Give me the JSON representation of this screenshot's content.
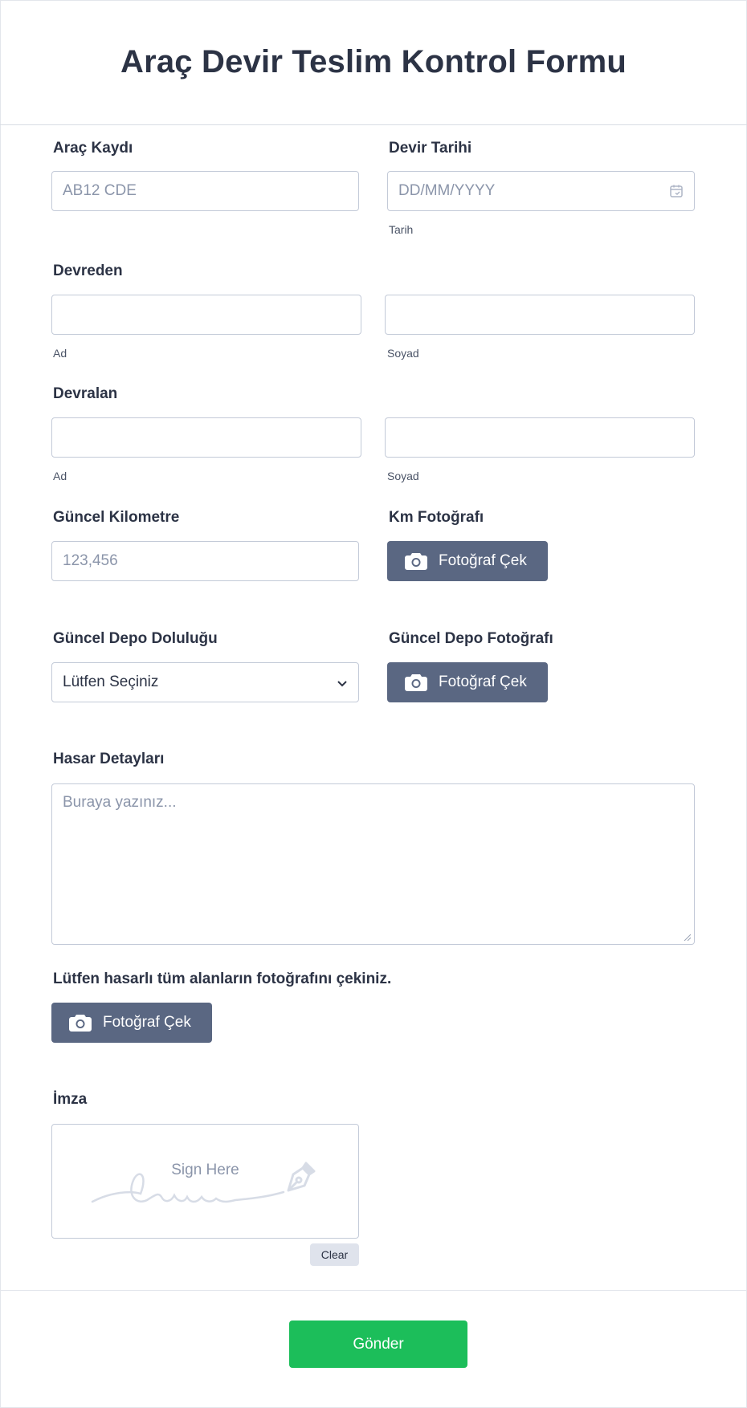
{
  "form": {
    "title": "Araç Devir Teslim Kontrol Formu",
    "vehicle": {
      "label": "Araç Kaydı",
      "placeholder": "AB12 CDE"
    },
    "date": {
      "label": "Devir Tarihi",
      "placeholder": "DD/MM/YYYY",
      "sublabel": "Tarih"
    },
    "deliverer": {
      "label": "Devreden",
      "first_sub": "Ad",
      "last_sub": "Soyad"
    },
    "receiver": {
      "label": "Devralan",
      "first_sub": "Ad",
      "last_sub": "Soyad"
    },
    "mileage": {
      "label": "Güncel Kilometre",
      "placeholder": "123,456"
    },
    "km_photo": {
      "label": "Km Fotoğrafı",
      "button": "Fotoğraf Çek"
    },
    "fuel": {
      "label": "Güncel Depo Doluluğu",
      "selected": "Lütfen Seçiniz"
    },
    "fuel_photo": {
      "label": "Güncel Depo Fotoğrafı",
      "button": "Fotoğraf Çek"
    },
    "damage": {
      "label": "Hasar Detayları",
      "placeholder": "Buraya yazınız..."
    },
    "damage_photo": {
      "label": "Lütfen hasarlı tüm alanların fotoğrafını çekiniz.",
      "button": "Fotoğraf Çek"
    },
    "signature": {
      "label": "İmza",
      "hint": "Sign Here",
      "clear": "Clear"
    },
    "submit": "Gönder"
  },
  "colors": {
    "text": "#2c3345",
    "placeholder": "#8b95aa",
    "photo_button": "#5a6782",
    "submit_button": "#1cbe5a",
    "border": "#c3cad8"
  },
  "icons": [
    "calendar-icon",
    "chevron-down-icon",
    "camera-icon",
    "pen-nib-icon",
    "resize-handle-icon"
  ]
}
